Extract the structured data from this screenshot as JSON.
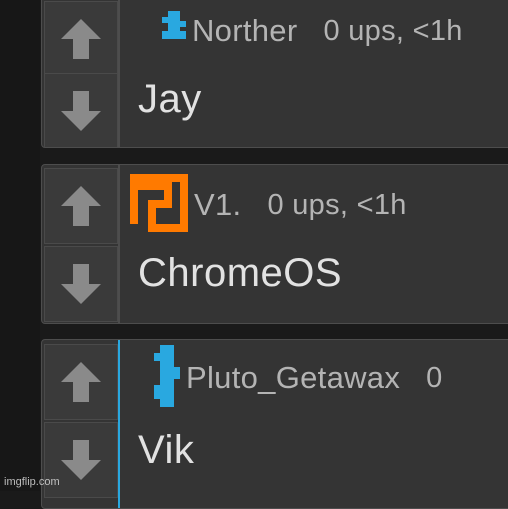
{
  "comments": [
    {
      "username": "Norther",
      "stats": "0 ups, <1h",
      "text": "Jay",
      "avatar_color": "#29a8e0",
      "avatar_icon": "pixel-avatar-icon",
      "highlighted": false
    },
    {
      "username": "V1.",
      "stats": "0 ups, <1h",
      "text": "ChromeOS",
      "avatar_color": "#ff7a00",
      "avatar_icon": "pixel-avatar-icon",
      "highlighted": false
    },
    {
      "username": "Pluto_Getawax",
      "stats": "0",
      "text": "Vik",
      "avatar_color": "#29a8e0",
      "avatar_icon": "pixel-avatar-icon",
      "highlighted": true
    }
  ],
  "colors": {
    "background": "#1a1a1a",
    "card": "#343434",
    "border": "#4d4d4d",
    "highlight_border": "#29a8e0",
    "arrow": "#8a8a8a"
  },
  "watermark": "imgflip.com"
}
